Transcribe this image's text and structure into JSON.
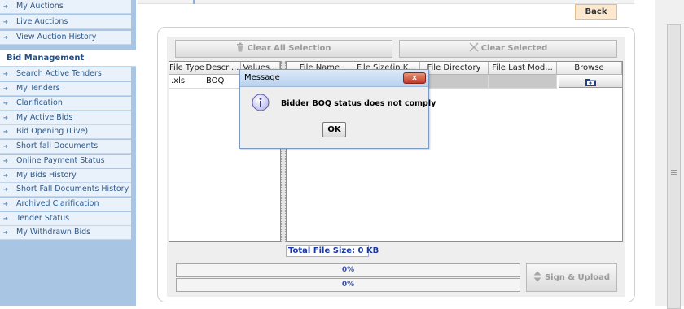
{
  "sidebar": {
    "top_items": [
      {
        "label": "My Auctions"
      },
      {
        "label": "Live Auctions"
      },
      {
        "label": "View Auction History"
      }
    ],
    "section_title": "Bid Management",
    "items": [
      {
        "label": "Search Active Tenders"
      },
      {
        "label": "My Tenders"
      },
      {
        "label": "Clarification"
      },
      {
        "label": "My Active Bids"
      },
      {
        "label": "Bid Opening (Live)"
      },
      {
        "label": "Short fall Documents"
      },
      {
        "label": "Online Payment Status"
      },
      {
        "label": "My Bids History"
      },
      {
        "label": "Short Fall Documents History"
      },
      {
        "label": "Archived Clarification"
      },
      {
        "label": "Tender Status"
      },
      {
        "label": "My Withdrawn Bids"
      }
    ],
    "arrow_glyph": "➔"
  },
  "header": {
    "back_label": "Back"
  },
  "toolbar": {
    "clear_all_label": "Clear All Selection",
    "clear_selected_label": "Clear Selected"
  },
  "table": {
    "left_headers": [
      "File Type",
      "Descri...",
      "Values..."
    ],
    "right_headers": [
      "File Name",
      "File Size(in K...",
      "File Directory",
      "File Last Mod...",
      "Browse"
    ],
    "row": {
      "file_type": ".xls",
      "description": "BOQ"
    }
  },
  "total_size_label": "Total File Size: 0 KB",
  "progress": [
    {
      "label": "0%",
      "value": 0
    },
    {
      "label": "0%",
      "value": 0
    }
  ],
  "sign_upload_label": "Sign & Upload",
  "dialog": {
    "title": "Message",
    "message": "Bidder BOQ status does not comply",
    "ok_label": "OK",
    "close_glyph": "x"
  },
  "colors": {
    "sidebar_bg": "#a9c5e4",
    "sidebar_item_bg": "#e9f1fa",
    "back_button": "#fce8cf",
    "progress_text": "#3a55a8",
    "total_size_text": "#1a37a0"
  }
}
